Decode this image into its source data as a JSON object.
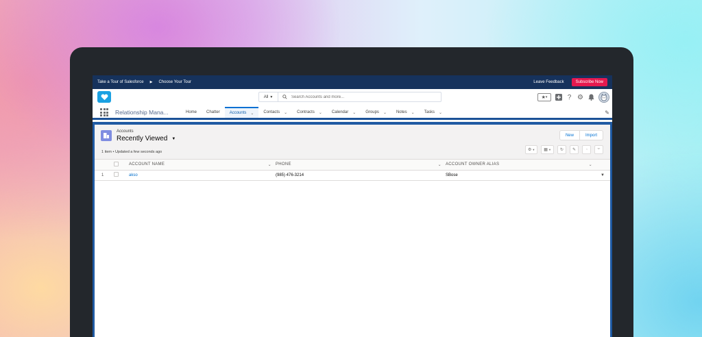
{
  "tour_bar": {
    "item1": "Take a Tour of Salesforce",
    "item2": "Choose Your Tour",
    "feedback": "Leave Feedback",
    "subscribe": "Subscribe Now",
    "colors": {
      "bar": "#16325c",
      "subscribe": "#e5194f"
    }
  },
  "header": {
    "search_scope": "All",
    "search_placeholder": "Search Accounts and more..."
  },
  "nav": {
    "app_name": "Relationship Mana...",
    "tabs": [
      {
        "label": "Home",
        "dropdown": false
      },
      {
        "label": "Chatter",
        "dropdown": false
      },
      {
        "label": "Accounts",
        "dropdown": true,
        "active": true
      },
      {
        "label": "Contacts",
        "dropdown": true
      },
      {
        "label": "Contracts",
        "dropdown": true
      },
      {
        "label": "Calendar",
        "dropdown": true
      },
      {
        "label": "Groups",
        "dropdown": true
      },
      {
        "label": "Notes",
        "dropdown": true
      },
      {
        "label": "Tasks",
        "dropdown": true
      }
    ]
  },
  "list_view": {
    "object_label": "Accounts",
    "view_name": "Recently Viewed",
    "status": "1 item • Updated a few seconds ago",
    "buttons": {
      "new": "New",
      "import": "Import"
    },
    "columns": [
      "ACCOUNT NAME",
      "PHONE",
      "ACCOUNT OWNER ALIAS"
    ],
    "rows": [
      {
        "num": "1",
        "account_name": "akso",
        "phone": "(985) 476-3214",
        "owner_alias": "SBose"
      }
    ]
  }
}
